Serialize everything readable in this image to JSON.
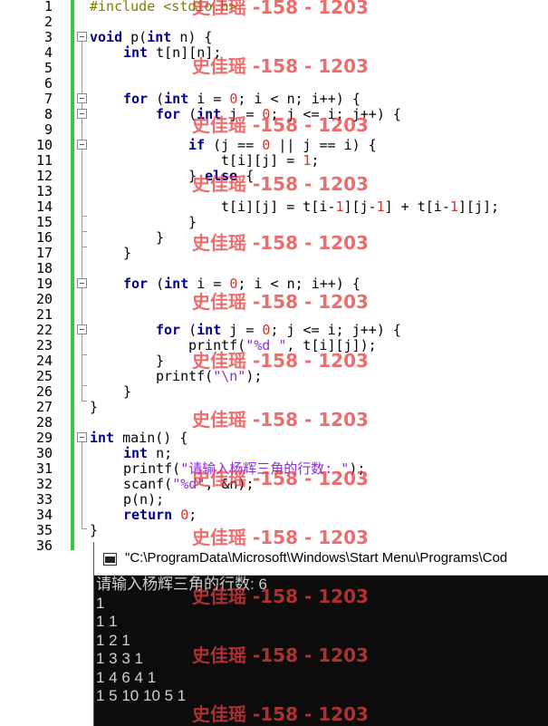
{
  "editor": {
    "line_numbers": [
      "1",
      "2",
      "3",
      "4",
      "5",
      "6",
      "7",
      "8",
      "9",
      "10",
      "11",
      "12",
      "13",
      "14",
      "15",
      "16",
      "17",
      "18",
      "19",
      "20",
      "21",
      "22",
      "23",
      "24",
      "25",
      "26",
      "27",
      "28",
      "29",
      "30",
      "31",
      "32",
      "33",
      "34",
      "35",
      "36"
    ],
    "code": {
      "l1": "#include <stdio.h>",
      "l3_kw": "void",
      "l3_rest": " p(",
      "l3_kw2": "int",
      "l3_end": " n) {",
      "l4_kw": "int",
      "l4_rest": " t[n][n];",
      "l7_kw": "for",
      "l7_a": " (",
      "l7_kw2": "int",
      "l7_b": " i = ",
      "l7_n": "0",
      "l7_c": "; i < n; i++) {",
      "l8_kw": "for",
      "l8_a": " (",
      "l8_kw2": "int",
      "l8_b": " j = ",
      "l8_n": "0",
      "l8_c": "; j <= i; j++) {",
      "l10_kw": "if",
      "l10_a": " (j == ",
      "l10_n": "0",
      "l10_b": " || j == i) {",
      "l11_a": "t[i][j] = ",
      "l11_n": "1",
      "l11_b": ";",
      "l12_a": "} ",
      "l12_kw": "else",
      "l12_b": " {",
      "l14_a": "t[i][j] = t[i-",
      "l14_n1": "1",
      "l14_b": "][j-",
      "l14_n2": "1",
      "l14_c": "] + t[i-",
      "l14_n3": "1",
      "l14_d": "][j];",
      "l15": "}",
      "l16": "}",
      "l17": "}",
      "l19_kw": "for",
      "l19_a": " (",
      "l19_kw2": "int",
      "l19_b": " i = ",
      "l19_n": "0",
      "l19_c": "; i < n; i++) {",
      "l22_kw": "for",
      "l22_a": " (",
      "l22_kw2": "int",
      "l22_b": " j = ",
      "l22_n": "0",
      "l22_c": "; j <= i; j++) {",
      "l23_a": "printf(",
      "l23_s": "\"%d \"",
      "l23_b": ", t[i][j]);",
      "l24": "}",
      "l25_a": "printf(",
      "l25_s": "\"\\n\"",
      "l25_b": ");",
      "l26": "}",
      "l27": "}",
      "l29_kw": "int",
      "l29_a": " main() {",
      "l30_kw": "int",
      "l30_a": " n;",
      "l31_a": "printf(",
      "l31_s": "\"请输入杨辉三角的行数: \"",
      "l31_b": ");",
      "l32_a": "scanf(",
      "l32_s": "\"%d\"",
      "l32_b": ", &n);",
      "l33": "p(n);",
      "l34_kw": "return",
      "l34_a": " ",
      "l34_n": "0",
      "l34_b": ";",
      "l35": "}"
    }
  },
  "watermark": "史佳瑶 -158 - 1203",
  "console": {
    "title": "\"C:\\ProgramData\\Microsoft\\Windows\\Start Menu\\Programs\\Cod",
    "lines": [
      "请输入杨辉三角的行数: 6",
      "1",
      "1 1",
      "1 2 1",
      "1 3 3 1",
      "1 4 6 4 1",
      "1 5 10 10 5 1"
    ]
  },
  "colors": {
    "keyword": "#00008b",
    "number": "#e0301e",
    "string": "#8a2be2",
    "preprocessor": "#7d7d00",
    "change_bar": "#2ecc40",
    "watermark": "#e63c3c",
    "console_bg": "#0c0c0c"
  }
}
